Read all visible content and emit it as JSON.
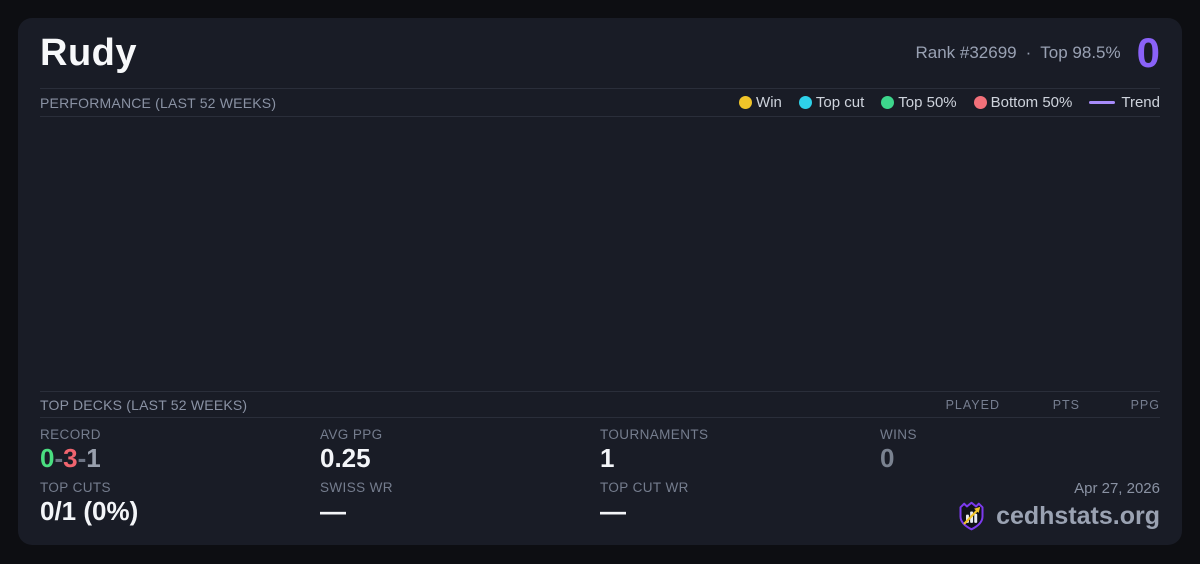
{
  "colors": {
    "background": "#0d0e12",
    "card": "#191c26",
    "divider": "#2a2e3a",
    "accent_purple": "#8a62f8",
    "win_yellow": "#f0c429",
    "top_cut_cyan": "#2ed1e9",
    "top50_green": "#3dd68c",
    "bottom50_red": "#f2707a",
    "trend_lavender": "#a78bfa",
    "record_win_green": "#4ade80",
    "record_loss_red": "#f0646e",
    "record_draw_gray": "#99a0ad"
  },
  "header": {
    "player_name": "Rudy",
    "rank_text": "Rank #32699",
    "separator": "·",
    "top_percent": "Top 98.5%",
    "badge_value": "0"
  },
  "performance": {
    "title": "PERFORMANCE (LAST 52 WEEKS)",
    "legend": [
      {
        "label": "Win",
        "color": "#f0c429",
        "swatch": "dot"
      },
      {
        "label": "Top cut",
        "color": "#2ed1e9",
        "swatch": "dot"
      },
      {
        "label": "Top 50%",
        "color": "#3dd68c",
        "swatch": "dot"
      },
      {
        "label": "Bottom 50%",
        "color": "#f2707a",
        "swatch": "dot"
      },
      {
        "label": "Trend",
        "color": "#a78bfa",
        "swatch": "line"
      }
    ]
  },
  "chart_data": {
    "type": "scatter",
    "title": "PERFORMANCE (LAST 52 WEEKS)",
    "series": [
      {
        "name": "Win",
        "color": "#f0c429",
        "points": []
      },
      {
        "name": "Top cut",
        "color": "#2ed1e9",
        "points": []
      },
      {
        "name": "Top 50%",
        "color": "#3dd68c",
        "points": []
      },
      {
        "name": "Bottom 50%",
        "color": "#f2707a",
        "points": []
      },
      {
        "name": "Trend",
        "color": "#a78bfa",
        "points": []
      }
    ],
    "legend_position": "top-right",
    "grid": false,
    "axes_visible": false,
    "note": "plot area rendered empty - no data points visible"
  },
  "top_decks": {
    "title": "TOP DECKS (LAST 52 WEEKS)",
    "columns": [
      "PLAYED",
      "PTS",
      "PPG"
    ],
    "rows": []
  },
  "stats": {
    "record": {
      "label": "RECORD",
      "wins": "0",
      "losses": "3",
      "draws": "1",
      "separator": "-"
    },
    "avg_ppg": {
      "label": "AVG PPG",
      "value": "0.25"
    },
    "tournaments": {
      "label": "TOURNAMENTS",
      "value": "1"
    },
    "wins": {
      "label": "WINS",
      "value": "0"
    },
    "top_cuts": {
      "label": "TOP CUTS",
      "value": "0/1 (0%)"
    },
    "swiss_wr": {
      "label": "SWISS WR",
      "value": "—"
    },
    "top_cut_wr": {
      "label": "TOP CUT WR",
      "value": "—"
    }
  },
  "footer": {
    "date": "Apr 27, 2026",
    "brand": "cedhstats.org"
  }
}
